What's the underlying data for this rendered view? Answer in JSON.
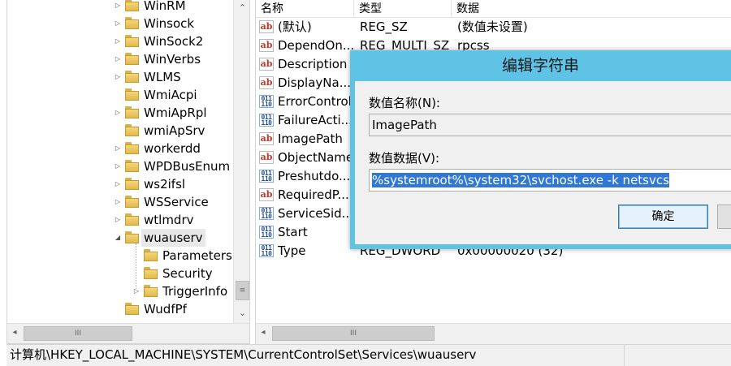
{
  "tree": {
    "items": [
      {
        "label": "WinRM",
        "expander": "▷"
      },
      {
        "label": "Winsock",
        "expander": "▷"
      },
      {
        "label": "WinSock2",
        "expander": "▷"
      },
      {
        "label": "WinVerbs",
        "expander": "▷"
      },
      {
        "label": "WLMS",
        "expander": "▷"
      },
      {
        "label": "WmiAcpi",
        "expander": ""
      },
      {
        "label": "WmiApRpl",
        "expander": "▷"
      },
      {
        "label": "wmiApSrv",
        "expander": ""
      },
      {
        "label": "workerdd",
        "expander": "▷"
      },
      {
        "label": "WPDBusEnum",
        "expander": "▷"
      },
      {
        "label": "ws2ifsl",
        "expander": "▷"
      },
      {
        "label": "WSService",
        "expander": "▷"
      },
      {
        "label": "wtlmdrv",
        "expander": "▷"
      },
      {
        "label": "wuauserv",
        "expander": "◢"
      },
      {
        "label": "Parameters",
        "expander": ""
      },
      {
        "label": "Security",
        "expander": ""
      },
      {
        "label": "TriggerInfo",
        "expander": "▷"
      },
      {
        "label": "WudfPf",
        "expander": ""
      }
    ],
    "scroll_up": "⌃",
    "scroll_down": "⌄",
    "thumb_grip": "≡",
    "hscroll_left": "◂",
    "hscroll_grip": "III"
  },
  "list": {
    "columns": {
      "name": "名称",
      "type": "类型",
      "data": "数据"
    },
    "rows": [
      {
        "name": "(默认)",
        "type": "REG_SZ",
        "data": "(数值未设置)",
        "icon": "string-value-icon"
      },
      {
        "name": "DependOn...",
        "type": "REG_MULTI_SZ",
        "data": "rpcss",
        "icon": "string-value-icon"
      },
      {
        "name": "Description",
        "type": "",
        "data": "",
        "icon": "string-value-icon"
      },
      {
        "name": "DisplayNa...",
        "type": "",
        "data": "",
        "icon": "string-value-icon"
      },
      {
        "name": "ErrorControl",
        "type": "",
        "data": "",
        "icon": "binary-value-icon"
      },
      {
        "name": "FailureActi...",
        "type": "",
        "data": "",
        "icon": "binary-value-icon"
      },
      {
        "name": "ImagePath",
        "type": "",
        "data": "",
        "icon": "string-value-icon"
      },
      {
        "name": "ObjectName",
        "type": "",
        "data": "",
        "icon": "string-value-icon"
      },
      {
        "name": "Preshutdo...",
        "type": "",
        "data": "",
        "icon": "binary-value-icon"
      },
      {
        "name": "RequiredP...",
        "type": "",
        "data": "",
        "icon": "string-value-icon"
      },
      {
        "name": "ServiceSid...",
        "type": "",
        "data": "",
        "icon": "binary-value-icon"
      },
      {
        "name": "Start",
        "type": "",
        "data": "",
        "icon": "binary-value-icon"
      },
      {
        "name": "Type",
        "type": "REG_DWORD",
        "data": "0x00000020 (32)",
        "icon": "binary-value-icon"
      }
    ],
    "hscroll_left": "◂",
    "hscroll_grip": "III"
  },
  "status": {
    "path": "计算机\\HKEY_LOCAL_MACHINE\\SYSTEM\\CurrentControlSet\\Services\\wuauserv"
  },
  "dialog": {
    "title": "编辑字符串",
    "name_label": "数值名称(N):",
    "name_value": "ImagePath",
    "data_label": "数值数据(V):",
    "data_value": "%systemroot%\\system32\\svchost.exe -k netsvcs",
    "ok_label": "确定",
    "cancel_label": ""
  },
  "colors": {
    "dialog_title_bar": "#5fc3e6",
    "selection_highlight": "#3178d6"
  }
}
